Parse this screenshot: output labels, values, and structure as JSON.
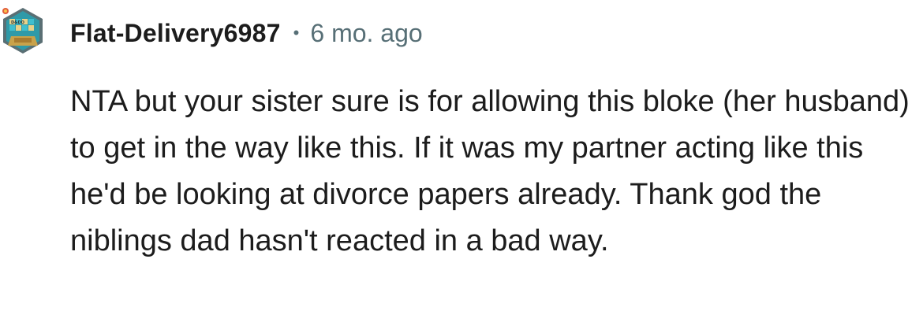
{
  "comment": {
    "author": "Flat-Delivery6987",
    "separator": "•",
    "timestamp": "6 mo. ago",
    "avatar": {
      "icon": "snoovatar-game-board-icon",
      "badge_text": "D&DO"
    },
    "body": "NTA but your sister sure is for allowing this bloke (her husband) to get in the way like this. If it was my partner acting like this he'd be looking at divorce papers already. Thank god the niblings dad hasn't reacted in a bad way."
  },
  "colors": {
    "text_primary": "#1c1c1c",
    "text_meta": "#576f76",
    "background": "#ffffff",
    "avatar_teal": "#2f9aa8",
    "avatar_gold": "#c9a24a"
  }
}
